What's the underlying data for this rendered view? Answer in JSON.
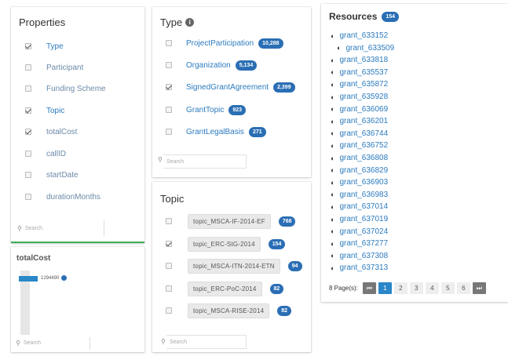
{
  "properties": {
    "title": "Properties",
    "items": [
      {
        "label": "Type",
        "checked": true,
        "style": "link"
      },
      {
        "label": "Participant",
        "checked": false,
        "style": "muted"
      },
      {
        "label": "Funding Scheme",
        "checked": false,
        "style": "muted"
      },
      {
        "label": "Topic",
        "checked": true,
        "style": "link"
      },
      {
        "label": "totalCost",
        "checked": true,
        "style": "muted"
      },
      {
        "label": "callID",
        "checked": false,
        "style": "muted"
      },
      {
        "label": "startDate",
        "checked": false,
        "style": "muted"
      },
      {
        "label": "durationMonths",
        "checked": false,
        "style": "muted"
      }
    ],
    "search_placeholder": "Search"
  },
  "totalcost": {
    "title": "totalCost",
    "slider_value": "1294490",
    "slider_level": 0.9,
    "search_placeholder": "Search"
  },
  "type": {
    "title": "Type",
    "items": [
      {
        "label": "ProjectParticipation",
        "count": "10,288",
        "checked": false
      },
      {
        "label": "Organization",
        "count": "5,134",
        "checked": false
      },
      {
        "label": "SignedGrantAgreement",
        "count": "2,399",
        "checked": true
      },
      {
        "label": "GrantTopic",
        "count": "923",
        "checked": false
      },
      {
        "label": "GrantLegalBasis",
        "count": "271",
        "checked": false
      }
    ],
    "search_placeholder": "Search"
  },
  "topic": {
    "title": "Topic",
    "items": [
      {
        "label": "topic_MSCA-IF-2014-EF",
        "count": "768",
        "checked": false
      },
      {
        "label": "topic_ERC-StG-2014",
        "count": "154",
        "checked": true
      },
      {
        "label": "topic_MSCA-ITN-2014-ETN",
        "count": "94",
        "checked": false
      },
      {
        "label": "topic_ERC-PoC-2014",
        "count": "82",
        "checked": false
      },
      {
        "label": "topic_MSCA-RISE-2014",
        "count": "82",
        "checked": false
      }
    ],
    "search_placeholder": "Search"
  },
  "resources": {
    "title": "Resources",
    "count": "154",
    "items": [
      {
        "label": "grant_633152",
        "indent": false
      },
      {
        "label": "grant_633509",
        "indent": true
      },
      {
        "label": "grant_633818",
        "indent": false
      },
      {
        "label": "grant_635537",
        "indent": false
      },
      {
        "label": "grant_635872",
        "indent": false
      },
      {
        "label": "grant_635928",
        "indent": false
      },
      {
        "label": "grant_636069",
        "indent": false
      },
      {
        "label": "grant_636201",
        "indent": false
      },
      {
        "label": "grant_636744",
        "indent": false
      },
      {
        "label": "grant_636752",
        "indent": false
      },
      {
        "label": "grant_636808",
        "indent": false
      },
      {
        "label": "grant_636829",
        "indent": false
      },
      {
        "label": "grant_636903",
        "indent": false
      },
      {
        "label": "grant_636983",
        "indent": false
      },
      {
        "label": "grant_637014",
        "indent": false
      },
      {
        "label": "grant_637019",
        "indent": false
      },
      {
        "label": "grant_637024",
        "indent": false
      },
      {
        "label": "grant_637277",
        "indent": false
      },
      {
        "label": "grant_637308",
        "indent": false
      },
      {
        "label": "grant_637313",
        "indent": false
      }
    ],
    "pager": {
      "label": "8 Page(s):",
      "first": "⏮",
      "pages": [
        "1",
        "2",
        "3",
        "4",
        "5",
        "6"
      ],
      "current": "1",
      "last": "⏭"
    }
  },
  "colors": {
    "accent": "#2a6eb4",
    "link": "#2c7bbf",
    "green_border": "#3fae5a",
    "slider": "#2a87c8"
  },
  "icons": {
    "info": "info-icon",
    "search": "search-icon",
    "grant": "grant-icon"
  }
}
